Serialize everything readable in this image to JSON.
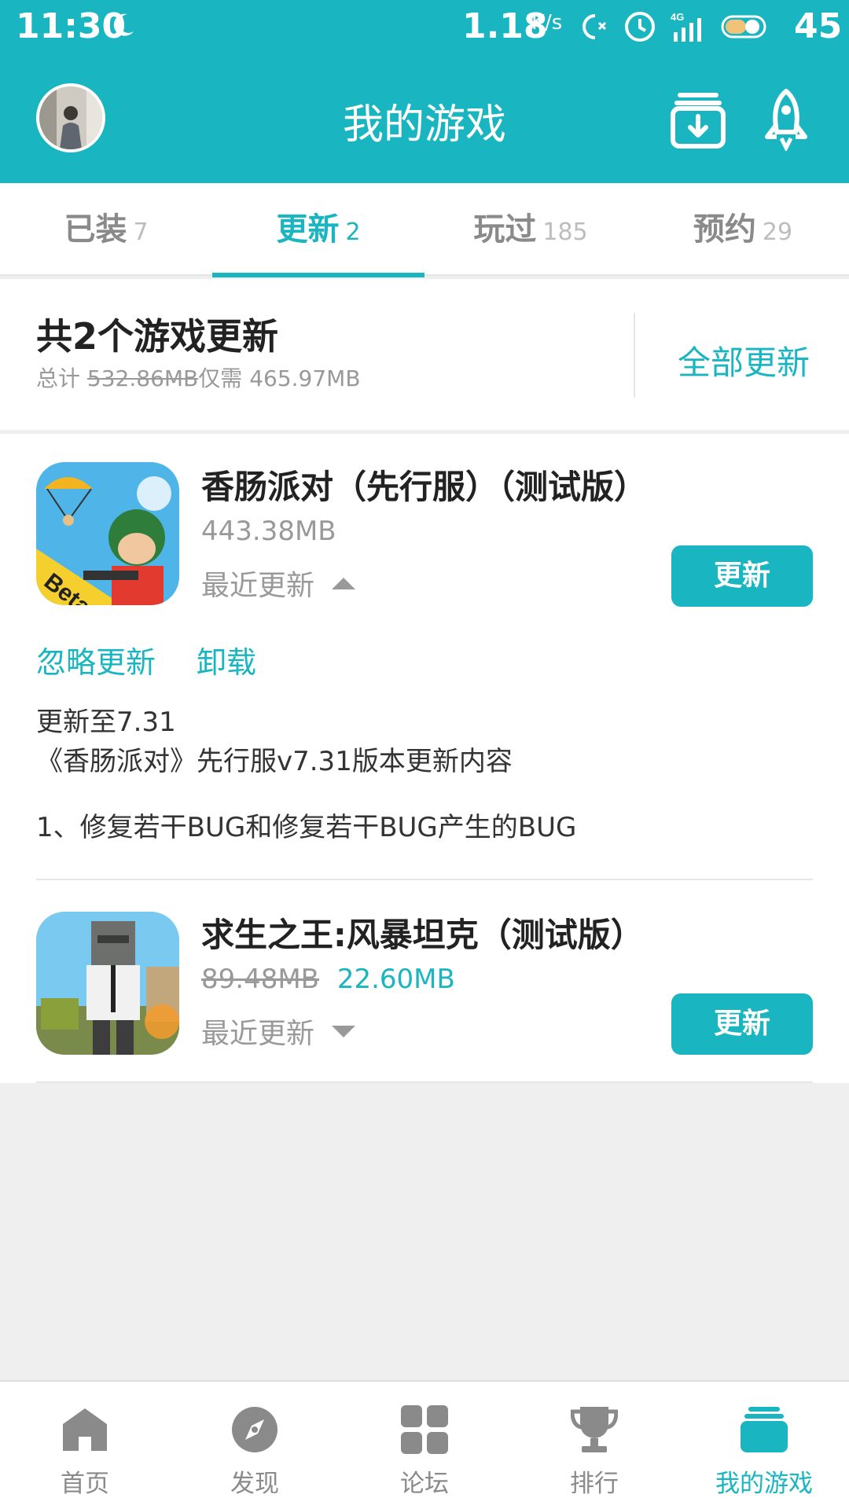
{
  "colors": {
    "accent": "#19b5c0",
    "muted": "#999999",
    "background": "#efefef"
  },
  "status_bar": {
    "time": "11:30",
    "net_speed": "1.18",
    "net_unit": "K/s",
    "battery": "45"
  },
  "header": {
    "title": "我的游戏",
    "download_icon": "download-box-icon",
    "rocket_icon": "rocket-icon"
  },
  "tabs": [
    {
      "label": "已装",
      "count": "7"
    },
    {
      "label": "更新",
      "count": "2",
      "active": true
    },
    {
      "label": "玩过",
      "count": "185"
    },
    {
      "label": "预约",
      "count": "29"
    }
  ],
  "summary": {
    "title": "共2个游戏更新",
    "total_prefix": "总计",
    "total_original": "532.86MB",
    "only_need_prefix": "仅需",
    "only_need": "465.97MB",
    "update_all": "全部更新"
  },
  "games": [
    {
      "name": "香肠派对（先行服）（测试版）",
      "size": "443.38MB",
      "recent": "最近更新",
      "button": "更新",
      "ignore": "忽略更新",
      "uninstall": "卸载",
      "notes": {
        "line1": "更新至7.31",
        "line2": "《香肠派对》先行服v7.31版本更新内容",
        "line3": "1、修复若干BUG和修复若干BUG产生的BUG"
      },
      "badge": "Beta"
    },
    {
      "name": "求生之王:风暴坦克（测试版）",
      "size_original": "89.48MB",
      "size": "22.60MB",
      "recent": "最近更新",
      "button": "更新"
    }
  ],
  "bottom_nav": [
    {
      "label": "首页",
      "icon": "home-icon"
    },
    {
      "label": "发现",
      "icon": "compass-icon"
    },
    {
      "label": "论坛",
      "icon": "grid-icon"
    },
    {
      "label": "排行",
      "icon": "trophy-icon"
    },
    {
      "label": "我的游戏",
      "icon": "stack-icon",
      "active": true
    }
  ]
}
